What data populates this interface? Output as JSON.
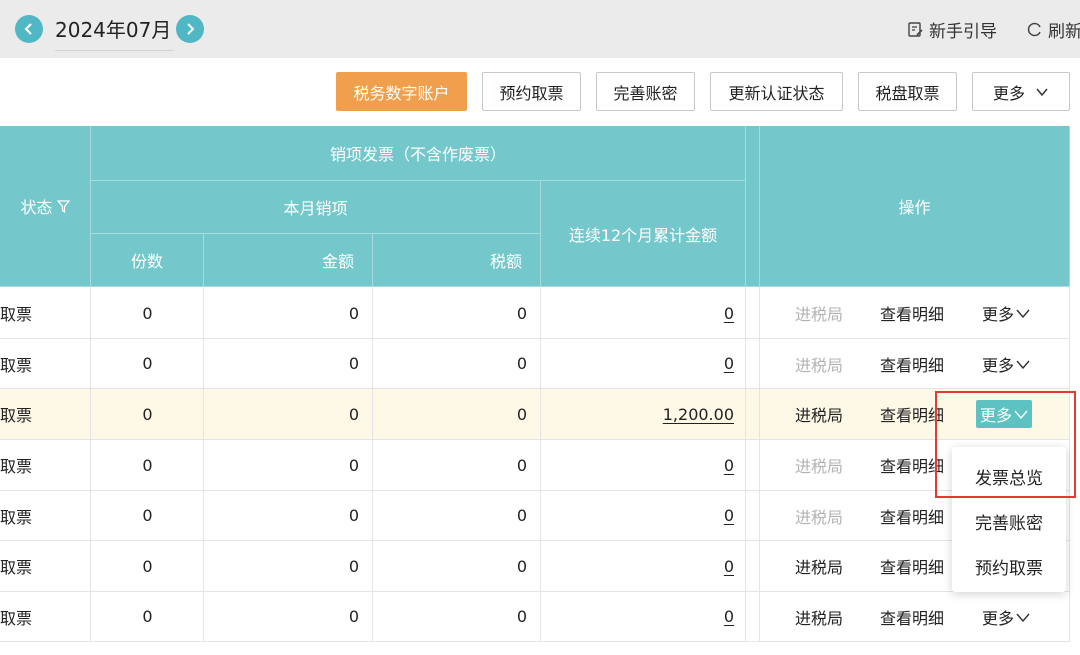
{
  "header": {
    "period": "2024年07月",
    "guide_label": "新手引导",
    "refresh_label": "刷新"
  },
  "toolbar": {
    "buttons": [
      "税务数字账户",
      "预约取票",
      "完善账密",
      "更新认证状态",
      "税盘取票",
      "更多"
    ]
  },
  "table": {
    "status_header": "状态",
    "group_header": "销项发票（不含作废票）",
    "month_header": "本月销项",
    "cols": [
      "份数",
      "金额",
      "税额"
    ],
    "cumulative_header": "连续12个月累计金额",
    "ops_header": "操作",
    "rows": [
      {
        "status": "取票",
        "count": "0",
        "amount": "0",
        "tax": "0",
        "cum": "0",
        "enter": "进税局",
        "enter_enabled": false,
        "detail": "查看明细",
        "more": "更多"
      },
      {
        "status": "取票",
        "count": "0",
        "amount": "0",
        "tax": "0",
        "cum": "0",
        "enter": "进税局",
        "enter_enabled": false,
        "detail": "查看明细",
        "more": "更多"
      },
      {
        "status": "取票",
        "count": "0",
        "amount": "0",
        "tax": "0",
        "cum": "1,200.00",
        "enter": "进税局",
        "enter_enabled": true,
        "detail": "查看明细",
        "more": "更多"
      },
      {
        "status": "取票",
        "count": "0",
        "amount": "0",
        "tax": "0",
        "cum": "0",
        "enter": "进税局",
        "enter_enabled": false,
        "detail": "查看明细",
        "more": ""
      },
      {
        "status": "取票",
        "count": "0",
        "amount": "0",
        "tax": "0",
        "cum": "0",
        "enter": "进税局",
        "enter_enabled": false,
        "detail": "查看明细",
        "more": ""
      },
      {
        "status": "取票",
        "count": "0",
        "amount": "0",
        "tax": "0",
        "cum": "0",
        "enter": "进税局",
        "enter_enabled": true,
        "detail": "查看明细",
        "more": ""
      },
      {
        "status": "取票",
        "count": "0",
        "amount": "0",
        "tax": "0",
        "cum": "0",
        "enter": "进税局",
        "enter_enabled": true,
        "detail": "查看明细",
        "more": "更多"
      }
    ]
  },
  "dropdown": {
    "items": [
      "发票总览",
      "完善账密",
      "预约取票"
    ]
  },
  "colors": {
    "header_teal": "#74c8cb",
    "primary_orange": "#f0a04c",
    "highlight_row": "#fdf9e6",
    "annotation_red": "#e53a31"
  }
}
